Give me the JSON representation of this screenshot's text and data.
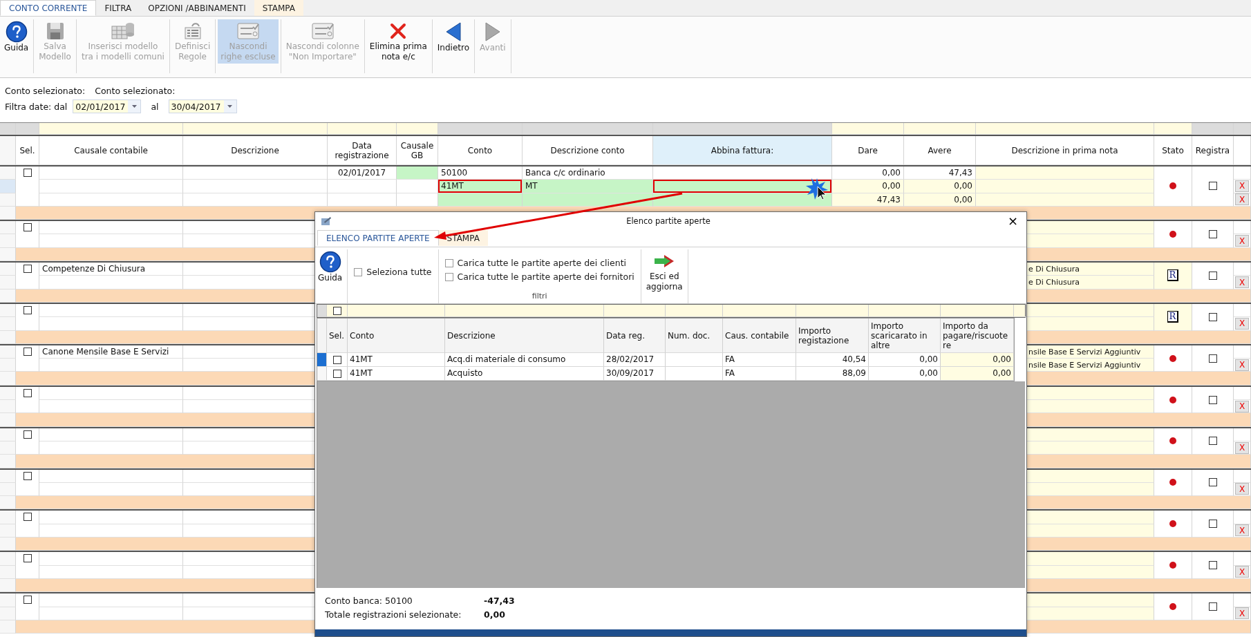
{
  "tabs": [
    {
      "label": "CONTO CORRENTE",
      "selected": true,
      "kind": "standard"
    },
    {
      "label": "FILTRA",
      "selected": false,
      "kind": "standard"
    },
    {
      "label": "OPZIONI /ABBINAMENTI",
      "selected": false,
      "kind": "standard"
    },
    {
      "label": "STAMPA",
      "selected": false,
      "kind": "contextual"
    }
  ],
  "toolbar": [
    {
      "kind": "help",
      "label": "Guida",
      "disabled": false,
      "pressed": false
    },
    {
      "kind": "save",
      "label": "Salva\nModello",
      "disabled": true,
      "pressed": false
    },
    {
      "kind": "template",
      "label": "Inserisci modello\ntra i modelli comuni",
      "disabled": true,
      "pressed": false
    },
    {
      "kind": "rules",
      "label": "Definisci\nRegole",
      "disabled": true,
      "pressed": false
    },
    {
      "kind": "hide-rows",
      "label": "Nascondi\nrighe escluse",
      "disabled": true,
      "pressed": true
    },
    {
      "kind": "hide-columns",
      "label": "Nascondi colonne\n\"Non Importare\"",
      "disabled": true,
      "pressed": false
    },
    {
      "kind": "delete",
      "label": "Elimina prima\nnota e/c",
      "disabled": false,
      "pressed": false
    },
    {
      "kind": "back",
      "label": "Indietro",
      "disabled": false,
      "pressed": false
    },
    {
      "kind": "forward",
      "label": "Avanti",
      "disabled": true,
      "pressed": false
    }
  ],
  "account_info": [
    "Conto selezionato:",
    "Conto selezionato:"
  ],
  "date_filter": {
    "label": "Filtra date: dal",
    "from": "02/01/2017",
    "to_label": "al",
    "to": "30/04/2017"
  },
  "grid": {
    "columns": [
      {
        "label": "Sel.",
        "selected": false
      },
      {
        "label": "Causale contabile",
        "selected": false
      },
      {
        "label": "Descrizione",
        "selected": false
      },
      {
        "label": "Data registrazione",
        "selected": false
      },
      {
        "label": "Causale GB",
        "selected": false
      },
      {
        "label": "Conto",
        "selected": false
      },
      {
        "label": "Descrizione conto",
        "selected": false
      },
      {
        "label": "Abbina fattura:",
        "selected": true
      },
      {
        "label": "Dare",
        "selected": false
      },
      {
        "label": "Avere",
        "selected": false
      },
      {
        "label": "Descrizione in prima nota",
        "selected": false
      },
      {
        "label": "Stato",
        "selected": false
      },
      {
        "label": "Registra",
        "selected": false
      }
    ],
    "groups": [
      {
        "checked": false,
        "registra_checked": false,
        "status": {
          "kind": "dot"
        },
        "rows": [
          {
            "kind": "bank",
            "selected": false,
            "data": "02/01/2017",
            "conto": "50100",
            "descrizione_conto": "Banca c/c ordinario",
            "dare": "0,00",
            "avere": "47,43"
          },
          {
            "kind": "match",
            "selected": true,
            "conto": "41MT",
            "conto_highlighted": true,
            "descrizione_conto": "MT",
            "abbina_highlighted": true,
            "dare": "0,00",
            "avere": "0,00",
            "delete_label": "X"
          },
          {
            "kind": "balance",
            "selected": false,
            "dare": "47,43",
            "avere": "0,00",
            "delete_label": "X"
          }
        ]
      },
      {
        "checked": false,
        "registra_checked": false,
        "status": {
          "kind": "dot"
        },
        "rows": [
          {
            "kind": "plain",
            "selected": false
          },
          {
            "kind": "plain",
            "selected": false,
            "delete_label": "X"
          }
        ]
      },
      {
        "checked": false,
        "registra_checked": false,
        "status": {
          "kind": "badge",
          "label": "R"
        },
        "rows": [
          {
            "kind": "plain",
            "selected": false,
            "causale": "Competenze Di Chiusura",
            "prima_nota": "e Di Chiusura"
          },
          {
            "kind": "plain",
            "selected": false,
            "prima_nota": "e Di Chiusura",
            "delete_label": "X"
          }
        ]
      },
      {
        "checked": false,
        "registra_checked": false,
        "status": {
          "kind": "badge",
          "label": "R"
        },
        "rows": [
          {
            "kind": "plain",
            "selected": false
          },
          {
            "kind": "plain",
            "selected": false,
            "delete_label": "X"
          }
        ]
      },
      {
        "checked": false,
        "registra_checked": false,
        "status": {
          "kind": "dot"
        },
        "rows": [
          {
            "kind": "plain",
            "selected": false,
            "causale": "Canone Mensile Base E Servizi",
            "prima_nota": "nsile Base E Servizi Aggiuntiv"
          },
          {
            "kind": "plain",
            "selected": false,
            "prima_nota": "nsile Base E Servizi Aggiuntiv",
            "delete_label": "X"
          }
        ]
      },
      {
        "checked": false,
        "registra_checked": false,
        "status": {
          "kind": "dot"
        },
        "rows": [
          {
            "kind": "plain",
            "selected": false
          },
          {
            "kind": "plain",
            "selected": false,
            "delete_label": "X"
          }
        ]
      },
      {
        "checked": false,
        "registra_checked": false,
        "status": {
          "kind": "dot"
        },
        "rows": [
          {
            "kind": "plain",
            "selected": false
          },
          {
            "kind": "plain",
            "selected": false,
            "delete_label": "X"
          }
        ]
      },
      {
        "checked": false,
        "registra_checked": false,
        "status": {
          "kind": "dot"
        },
        "rows": [
          {
            "kind": "plain",
            "selected": false
          },
          {
            "kind": "plain",
            "selected": false,
            "delete_label": "X"
          }
        ]
      },
      {
        "checked": false,
        "registra_checked": false,
        "status": {
          "kind": "dot"
        },
        "rows": [
          {
            "kind": "plain",
            "selected": false
          },
          {
            "kind": "plain",
            "selected": false,
            "delete_label": "X"
          }
        ]
      },
      {
        "checked": false,
        "registra_checked": false,
        "status": {
          "kind": "dot"
        },
        "rows": [
          {
            "kind": "plain",
            "selected": false
          },
          {
            "kind": "plain",
            "selected": false,
            "delete_label": "X"
          }
        ]
      },
      {
        "checked": false,
        "registra_checked": false,
        "status": {
          "kind": "dot"
        },
        "rows": [
          {
            "kind": "plain",
            "selected": false
          },
          {
            "kind": "plain",
            "selected": false,
            "delete_label": "X"
          }
        ]
      }
    ]
  },
  "dialog": {
    "title": "Elenco partite aperte",
    "close": "×",
    "tabs": [
      {
        "label": "ELENCO PARTITE APERTE",
        "selected": true,
        "kind": "standard"
      },
      {
        "label": "STAMPA",
        "selected": false,
        "kind": "contextual"
      }
    ],
    "help_button": "Guida",
    "select_all": {
      "label": "Seleziona tutte",
      "checked": false
    },
    "filters": [
      {
        "label": "Carica tutte le partite aperte dei clienti",
        "checked": false
      },
      {
        "label": "Carica tutte le partite aperte dei fornitori",
        "checked": false
      }
    ],
    "filters_group_label": "filtri",
    "exit_button": "Esci ed\naggiorna",
    "filter_row_checked": false,
    "columns": [
      "Sel.",
      "Conto",
      "Descrizione",
      "Data reg.",
      "Num. doc.",
      "Caus. contabile",
      "Importo registazione",
      "Importo scaricarato in altre",
      "Importo da pagare/riscuotere"
    ],
    "rows": [
      {
        "selected": true,
        "checked": false,
        "conto": "41MT",
        "descrizione": "Acq.di materiale di consumo",
        "data": "28/02/2017",
        "causale": "FA",
        "importo": "40,54",
        "scaricato": "0,00",
        "da_pagare": "0,00"
      },
      {
        "selected": false,
        "checked": false,
        "conto": "41MT",
        "descrizione": "Acquisto",
        "data": "30/09/2017",
        "causale": "FA",
        "importo": "88,09",
        "scaricato": "0,00",
        "da_pagare": "0,00"
      }
    ],
    "footer": [
      {
        "label": "Conto banca: 50100",
        "value": "-47,43"
      },
      {
        "label": "Totale registrazioni selezionate:",
        "value": "0,00"
      }
    ]
  }
}
